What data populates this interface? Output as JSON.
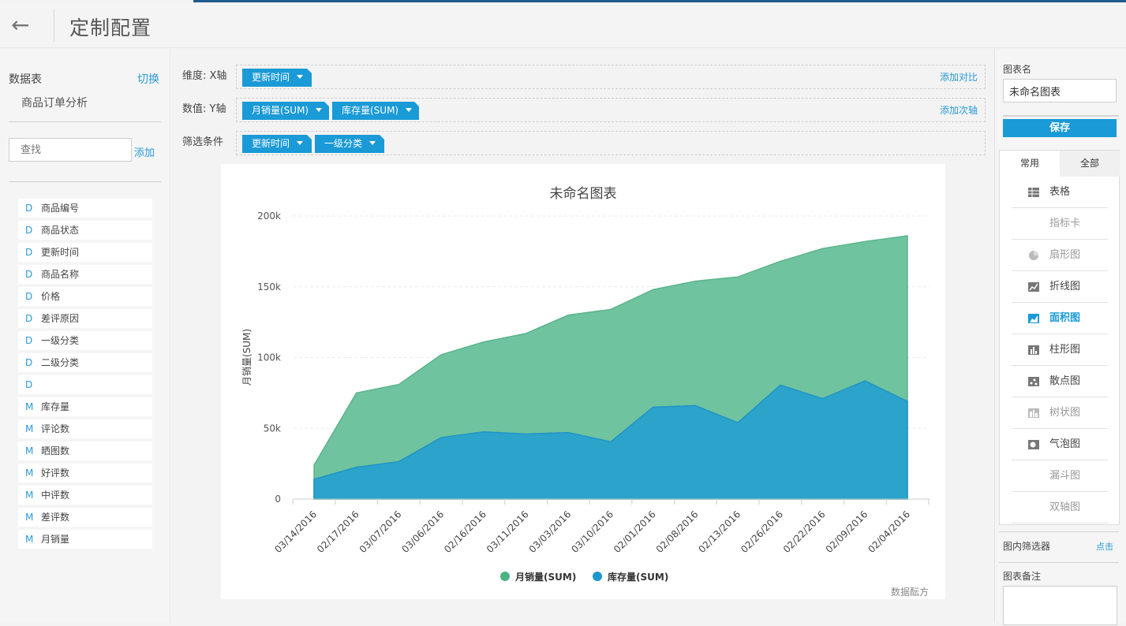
{
  "header": {
    "title": "定制配置"
  },
  "left": {
    "datatable_label": "数据表",
    "switch_label": "切换",
    "table_name": "商品订单分析",
    "search_placeholder": "查找",
    "add_label": "添加",
    "fields": [
      {
        "type": "D",
        "name": "商品编号"
      },
      {
        "type": "D",
        "name": "商品状态"
      },
      {
        "type": "D",
        "name": "更新时间"
      },
      {
        "type": "D",
        "name": "商品名称"
      },
      {
        "type": "D",
        "name": "价格"
      },
      {
        "type": "D",
        "name": "差评原因"
      },
      {
        "type": "D",
        "name": "一级分类"
      },
      {
        "type": "D",
        "name": "二级分类"
      },
      {
        "type": "D",
        "name": ""
      },
      {
        "type": "M",
        "name": "库存量"
      },
      {
        "type": "M",
        "name": "评论数"
      },
      {
        "type": "M",
        "name": "晒图数"
      },
      {
        "type": "M",
        "name": "好评数"
      },
      {
        "type": "M",
        "name": "中评数"
      },
      {
        "type": "M",
        "name": "差评数"
      },
      {
        "type": "M",
        "name": "月销量"
      }
    ]
  },
  "config": {
    "x_label": "维度: X轴",
    "x_pills": [
      "更新时间"
    ],
    "x_link": "添加对比",
    "y_label": "数值: Y轴",
    "y_pills": [
      "月销量(SUM)",
      "库存量(SUM)"
    ],
    "y_link": "添加次轴",
    "filter_label": "筛选条件",
    "filter_pills": [
      "更新时间",
      "一级分类"
    ]
  },
  "right": {
    "chart_name_label": "图表名",
    "chart_name_value": "未命名图表",
    "save_label": "保存",
    "tab_common": "常用",
    "tab_all": "全部",
    "chart_types": [
      {
        "label": "表格",
        "icon": "table-icon",
        "state": "normal"
      },
      {
        "label": "指标卡",
        "icon": "",
        "state": "disabled"
      },
      {
        "label": "扇形图",
        "icon": "pie-chart-icon",
        "state": "disabled"
      },
      {
        "label": "折线图",
        "icon": "line-chart-icon",
        "state": "normal"
      },
      {
        "label": "面积图",
        "icon": "area-chart-icon",
        "state": "selected"
      },
      {
        "label": "柱形图",
        "icon": "bar-chart-icon",
        "state": "normal"
      },
      {
        "label": "散点图",
        "icon": "scatter-chart-icon",
        "state": "normal"
      },
      {
        "label": "树状图",
        "icon": "treemap-icon",
        "state": "disabled"
      },
      {
        "label": "气泡图",
        "icon": "bubble-chart-icon",
        "state": "normal"
      },
      {
        "label": "漏斗图",
        "icon": "",
        "state": "disabled"
      },
      {
        "label": "双轴图",
        "icon": "",
        "state": "disabled"
      }
    ],
    "filter_label": "图内筛选器",
    "filter_link": "点击",
    "note_label": "图表备注"
  },
  "chart_data": {
    "type": "area",
    "title": "未命名图表",
    "ylabel": "月销量(SUM)",
    "credit": "数据酝方",
    "ylim": [
      0,
      200000
    ],
    "yticks": [
      "0",
      "50k",
      "100k",
      "150k",
      "200k"
    ],
    "categories": [
      "03/14/2016",
      "02/17/2016",
      "03/07/2016",
      "03/06/2016",
      "02/16/2016",
      "03/11/2016",
      "03/03/2016",
      "03/10/2016",
      "02/01/2016",
      "02/08/2016",
      "02/13/2016",
      "02/26/2016",
      "02/22/2016",
      "02/09/2016",
      "02/04/2016"
    ],
    "series": [
      {
        "name": "月销量(SUM)",
        "color": "#6fc39f",
        "values": [
          24000,
          75000,
          81000,
          102000,
          111000,
          117000,
          130000,
          134000,
          148000,
          154000,
          157000,
          168000,
          177000,
          182000,
          186000
        ]
      },
      {
        "name": "库存量(SUM)",
        "color": "#2ba3cb",
        "values": [
          14000,
          22500,
          26500,
          43500,
          47500,
          46000,
          47000,
          40500,
          65000,
          66000,
          54000,
          80500,
          71000,
          83500,
          69000
        ]
      }
    ],
    "legend_position": "bottom",
    "legend_marker_colors": [
      "#4cb386",
      "#1d96cc"
    ]
  }
}
